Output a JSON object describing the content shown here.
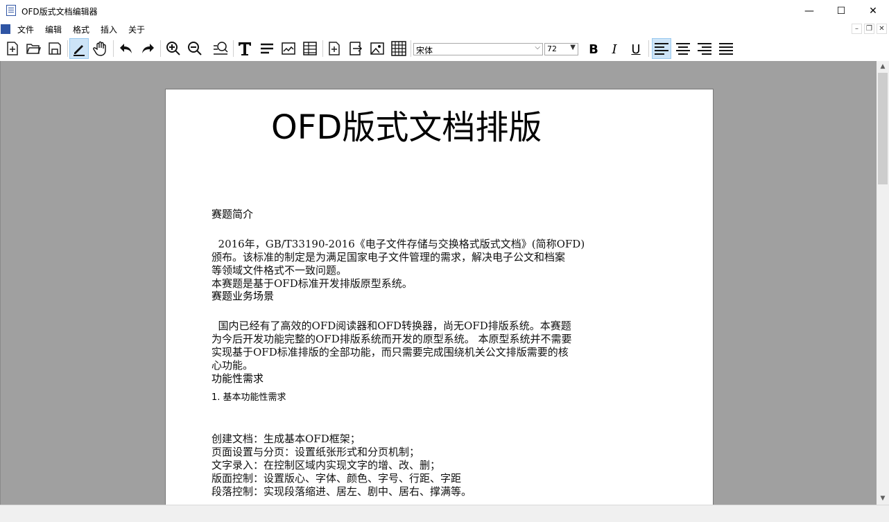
{
  "window": {
    "title": "OFD版式文档编辑器",
    "minimize": "—",
    "maximize": "☐",
    "close": "✕"
  },
  "menu": {
    "items": [
      "文件",
      "编辑",
      "格式",
      "插入",
      "关于"
    ]
  },
  "mdi": {
    "minimize": "–",
    "restore": "❐",
    "close": "✕"
  },
  "toolbar": {
    "font_family": "宋体",
    "font_size": "72",
    "bold": "B",
    "italic": "I",
    "underline": "U"
  },
  "document": {
    "title": "OFD版式文档排版",
    "section1_heading": "赛题简介",
    "section1_lines": [
      "  2016年，GB/T33190-2016《电子文件存储与交换格式版式文档》(简称OFD)",
      "颁布。该标准的制定是为满足国家电子文件管理的需求，解决电子公文和档案",
      "等领域文件格式不一致问题。",
      "本赛题是基于OFD标准开发排版原型系统。"
    ],
    "section2_heading": "赛题业务场景",
    "section2_lines": [
      "  国内已经有了高效的OFD阅读器和OFD转换器，尚无OFD排版系统。本赛题",
      "为今后开发功能完整的OFD排版系统而开发的原型系统。 本原型系统并不需要",
      "实现基于OFD标准排版的全部功能，而只需要完成围绕机关公文排版需要的核",
      "心功能。"
    ],
    "section3_heading": "功能性需求",
    "list_item": "1. 基本功能性需求",
    "req_lines": [
      "创建文档：生成基本OFD框架；",
      "页面设置与分页：设置纸张形式和分页机制；",
      "文字录入：在控制区域内实现文字的增、改、删；",
      "版面控制：设置版心、字体、颜色、字号、行距、字距",
      "段落控制：实现段落缩进、居左、剧中、居右、撑满等。"
    ]
  },
  "colors": {
    "workspace": "#a0a0a0",
    "active_tool": "#cde4f7",
    "accent": "#2f55a4"
  },
  "icons": [
    "new-document-icon",
    "open-folder-icon",
    "save-icon",
    "pen-icon",
    "hand-icon",
    "undo-icon",
    "redo-icon",
    "zoom-in-icon",
    "zoom-out-icon",
    "zoom-fit-icon",
    "text-icon",
    "paragraph-icon",
    "image-box-icon",
    "table-box-icon",
    "add-page-icon",
    "insert-icon",
    "picture-icon",
    "grid-icon",
    "align-left-icon",
    "align-center-icon",
    "align-right-icon",
    "justify-icon"
  ]
}
